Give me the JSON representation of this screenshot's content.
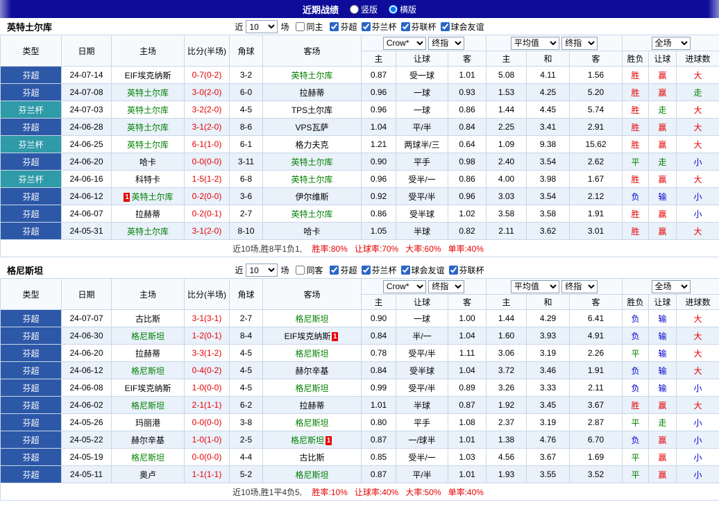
{
  "titlebar": {
    "title": "近期战绩",
    "vertical_label": "竖版",
    "horizontal_label": "横版",
    "selected": "横版"
  },
  "filters_labels": {
    "near": "近",
    "games": "场"
  },
  "table": {
    "cols": [
      "类型",
      "日期",
      "主场",
      "比分(半场)",
      "角球",
      "客场"
    ],
    "group1": [
      "主",
      "让球",
      "客"
    ],
    "group2": [
      "主",
      "和",
      "客"
    ],
    "group3": [
      "胜负",
      "让球",
      "进球数"
    ],
    "selects": {
      "bookmaker": "Crow*",
      "final_index": "终指",
      "average": "平均值",
      "full_match": "全场"
    }
  },
  "colors": {
    "titlebar-bg": "#0d0d9a",
    "league-super": "#2d58a8",
    "league-cup": "#2f9aa8",
    "win": "#e60000",
    "draw": "#008000",
    "lose": "#0000cc",
    "score": "#e60000",
    "tracked-team": "#008000",
    "row-alt": "#e9f1fb"
  },
  "sections": [
    {
      "team": "英特土尔库",
      "filters": {
        "count": "10",
        "same": "同主",
        "same_checked": false,
        "leagues": [
          {
            "label": "芬超",
            "checked": true
          },
          {
            "label": "芬兰杯",
            "checked": true
          },
          {
            "label": "芬联杯",
            "checked": true
          },
          {
            "label": "球会友谊",
            "checked": true
          }
        ]
      },
      "rows": [
        {
          "league": "芬超",
          "date": "24-07-14",
          "home": "EIF埃克纳斯",
          "score": "0-7(0-2)",
          "corner": "3-2",
          "away": "英特土尔库",
          "odds": [
            "0.87",
            "受一球",
            "1.01"
          ],
          "avg": [
            "5.08",
            "4.11",
            "1.56"
          ],
          "res": [
            "胜",
            "赢",
            "大"
          ]
        },
        {
          "league": "芬超",
          "date": "24-07-08",
          "home": "英特土尔库",
          "score": "3-0(2-0)",
          "corner": "6-0",
          "away": "拉赫蒂",
          "odds": [
            "0.96",
            "一球",
            "0.93"
          ],
          "avg": [
            "1.53",
            "4.25",
            "5.20"
          ],
          "res": [
            "胜",
            "赢",
            "走"
          ]
        },
        {
          "league": "芬兰杯",
          "date": "24-07-03",
          "home": "英特土尔库",
          "score": "3-2(2-0)",
          "corner": "4-5",
          "away": "TPS土尔库",
          "odds": [
            "0.96",
            "一球",
            "0.86"
          ],
          "avg": [
            "1.44",
            "4.45",
            "5.74"
          ],
          "res": [
            "胜",
            "走",
            "大"
          ]
        },
        {
          "league": "芬超",
          "date": "24-06-28",
          "home": "英特土尔库",
          "score": "3-1(2-0)",
          "corner": "8-6",
          "away": "VPS瓦萨",
          "odds": [
            "1.04",
            "平/半",
            "0.84"
          ],
          "avg": [
            "2.25",
            "3.41",
            "2.91"
          ],
          "res": [
            "胜",
            "赢",
            "大"
          ]
        },
        {
          "league": "芬兰杯",
          "date": "24-06-25",
          "home": "英特土尔库",
          "score": "6-1(1-0)",
          "corner": "6-1",
          "away": "格力夫克",
          "odds": [
            "1.21",
            "两球半/三",
            "0.64"
          ],
          "avg": [
            "1.09",
            "9.38",
            "15.62"
          ],
          "res": [
            "胜",
            "赢",
            "大"
          ]
        },
        {
          "league": "芬超",
          "date": "24-06-20",
          "home": "哈卡",
          "score": "0-0(0-0)",
          "corner": "3-11",
          "away": "英特土尔库",
          "odds": [
            "0.90",
            "平手",
            "0.98"
          ],
          "avg": [
            "2.40",
            "3.54",
            "2.62"
          ],
          "res": [
            "平",
            "走",
            "小"
          ]
        },
        {
          "league": "芬兰杯",
          "date": "24-06-16",
          "home": "科特卡",
          "score": "1-5(1-2)",
          "corner": "6-8",
          "away": "英特土尔库",
          "odds": [
            "0.96",
            "受半/一",
            "0.86"
          ],
          "avg": [
            "4.00",
            "3.98",
            "1.67"
          ],
          "res": [
            "胜",
            "赢",
            "大"
          ]
        },
        {
          "league": "芬超",
          "date": "24-06-12",
          "home": "英特土尔库",
          "home_card": "1",
          "score": "0-2(0-0)",
          "corner": "3-6",
          "away": "伊尔维斯",
          "odds": [
            "0.92",
            "受平/半",
            "0.96"
          ],
          "avg": [
            "3.03",
            "3.54",
            "2.12"
          ],
          "res": [
            "负",
            "输",
            "小"
          ]
        },
        {
          "league": "芬超",
          "date": "24-06-07",
          "home": "拉赫蒂",
          "score": "0-2(0-1)",
          "corner": "2-7",
          "away": "英特土尔库",
          "odds": [
            "0.86",
            "受半球",
            "1.02"
          ],
          "avg": [
            "3.58",
            "3.58",
            "1.91"
          ],
          "res": [
            "胜",
            "赢",
            "小"
          ]
        },
        {
          "league": "芬超",
          "date": "24-05-31",
          "home": "英特土尔库",
          "score": "3-1(2-0)",
          "corner": "8-10",
          "away": "哈卡",
          "odds": [
            "1.05",
            "半球",
            "0.82"
          ],
          "avg": [
            "2.11",
            "3.62",
            "3.01"
          ],
          "res": [
            "胜",
            "赢",
            "大"
          ]
        }
      ],
      "summary": {
        "prefix": "近10场,胜8平1负1,",
        "rates": [
          "胜率:80%",
          "让球率:70%",
          "大率:60%",
          "单率:40%"
        ]
      }
    },
    {
      "team": "格尼斯坦",
      "filters": {
        "count": "10",
        "same": "同客",
        "same_checked": false,
        "leagues": [
          {
            "label": "芬超",
            "checked": true
          },
          {
            "label": "芬兰杯",
            "checked": true
          },
          {
            "label": "球会友谊",
            "checked": true
          },
          {
            "label": "芬联杯",
            "checked": true
          }
        ]
      },
      "rows": [
        {
          "league": "芬超",
          "date": "24-07-07",
          "home": "古比斯",
          "score": "3-1(3-1)",
          "corner": "2-7",
          "away": "格尼斯坦",
          "odds": [
            "0.90",
            "一球",
            "1.00"
          ],
          "avg": [
            "1.44",
            "4.29",
            "6.41"
          ],
          "res": [
            "负",
            "输",
            "大"
          ]
        },
        {
          "league": "芬超",
          "date": "24-06-30",
          "home": "格尼斯坦",
          "score": "1-2(0-1)",
          "corner": "8-4",
          "away": "EIF埃克纳斯",
          "away_card": "1",
          "odds": [
            "0.84",
            "半/一",
            "1.04"
          ],
          "avg": [
            "1.60",
            "3.93",
            "4.91"
          ],
          "res": [
            "负",
            "输",
            "大"
          ]
        },
        {
          "league": "芬超",
          "date": "24-06-20",
          "home": "拉赫蒂",
          "score": "3-3(1-2)",
          "corner": "4-5",
          "away": "格尼斯坦",
          "odds": [
            "0.78",
            "受平/半",
            "1.11"
          ],
          "avg": [
            "3.06",
            "3.19",
            "2.26"
          ],
          "res": [
            "平",
            "输",
            "大"
          ]
        },
        {
          "league": "芬超",
          "date": "24-06-12",
          "home": "格尼斯坦",
          "score": "0-4(0-2)",
          "corner": "4-5",
          "away": "赫尔辛基",
          "odds": [
            "0.84",
            "受半球",
            "1.04"
          ],
          "avg": [
            "3.72",
            "3.46",
            "1.91"
          ],
          "res": [
            "负",
            "输",
            "大"
          ]
        },
        {
          "league": "芬超",
          "date": "24-06-08",
          "home": "EIF埃克纳斯",
          "score": "1-0(0-0)",
          "corner": "4-5",
          "away": "格尼斯坦",
          "odds": [
            "0.99",
            "受平/半",
            "0.89"
          ],
          "avg": [
            "3.26",
            "3.33",
            "2.11"
          ],
          "res": [
            "负",
            "输",
            "小"
          ]
        },
        {
          "league": "芬超",
          "date": "24-06-02",
          "home": "格尼斯坦",
          "score": "2-1(1-1)",
          "corner": "6-2",
          "away": "拉赫蒂",
          "odds": [
            "1.01",
            "半球",
            "0.87"
          ],
          "avg": [
            "1.92",
            "3.45",
            "3.67"
          ],
          "res": [
            "胜",
            "赢",
            "大"
          ]
        },
        {
          "league": "芬超",
          "date": "24-05-26",
          "home": "玛丽港",
          "score": "0-0(0-0)",
          "corner": "3-8",
          "away": "格尼斯坦",
          "odds": [
            "0.80",
            "平手",
            "1.08"
          ],
          "avg": [
            "2.37",
            "3.19",
            "2.87"
          ],
          "res": [
            "平",
            "走",
            "小"
          ]
        },
        {
          "league": "芬超",
          "date": "24-05-22",
          "home": "赫尔辛基",
          "score": "1-0(1-0)",
          "corner": "2-5",
          "away": "格尼斯坦",
          "away_card": "1",
          "odds": [
            "0.87",
            "一/球半",
            "1.01"
          ],
          "avg": [
            "1.38",
            "4.76",
            "6.70"
          ],
          "res": [
            "负",
            "赢",
            "小"
          ]
        },
        {
          "league": "芬超",
          "date": "24-05-19",
          "home": "格尼斯坦",
          "score": "0-0(0-0)",
          "corner": "4-4",
          "away": "古比斯",
          "odds": [
            "0.85",
            "受半/一",
            "1.03"
          ],
          "avg": [
            "4.56",
            "3.67",
            "1.69"
          ],
          "res": [
            "平",
            "赢",
            "小"
          ]
        },
        {
          "league": "芬超",
          "date": "24-05-11",
          "home": "奥卢",
          "score": "1-1(1-1)",
          "corner": "5-2",
          "away": "格尼斯坦",
          "odds": [
            "0.87",
            "平/半",
            "1.01"
          ],
          "avg": [
            "1.93",
            "3.55",
            "3.52"
          ],
          "res": [
            "平",
            "赢",
            "小"
          ]
        }
      ],
      "summary": {
        "prefix": "近10场,胜1平4负5,",
        "rates": [
          "胜率:10%",
          "让球率:40%",
          "大率:50%",
          "单率:40%"
        ]
      }
    }
  ]
}
